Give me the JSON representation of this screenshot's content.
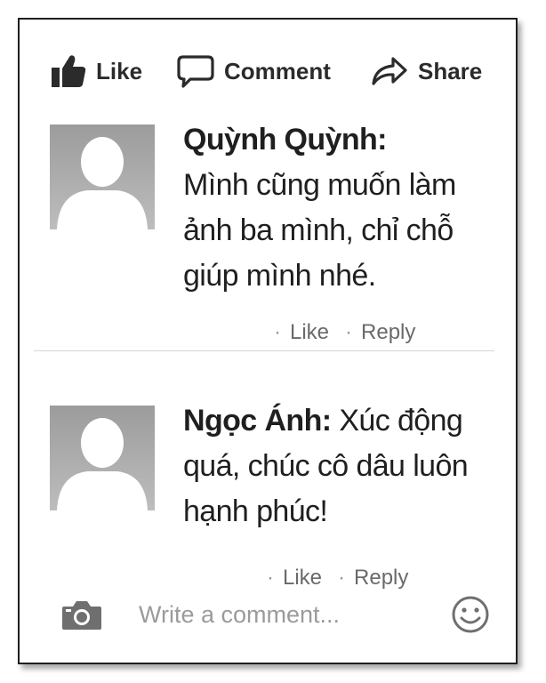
{
  "actions": {
    "like_label": "Like",
    "comment_label": "Comment",
    "share_label": "Share"
  },
  "comments": [
    {
      "author": "Quỳnh Quỳnh:",
      "text_lines": [
        "Mình cũng muốn làm",
        "ảnh ba mình, chỉ chỗ",
        "giúp mình nhé."
      ],
      "like_label": "Like",
      "reply_label": "Reply"
    },
    {
      "author": "Ngọc Ánh:",
      "first_line_rest": " Xúc động",
      "text_lines": [
        "quá, chúc cô dâu luôn",
        "hạnh phúc!"
      ],
      "like_label": "Like",
      "reply_label": "Reply"
    }
  ],
  "composer": {
    "placeholder": "Write a comment..."
  },
  "colors": {
    "frame_border": "#1e1e1e",
    "icon": "#2b2b2b",
    "avatar_bg": "#a8a8a8",
    "muted_text": "#6a6a6a"
  },
  "icons": [
    "thumbs-up-icon",
    "speech-bubble-icon",
    "share-arrow-icon",
    "camera-icon",
    "smiley-icon",
    "avatar-silhouette-icon"
  ]
}
